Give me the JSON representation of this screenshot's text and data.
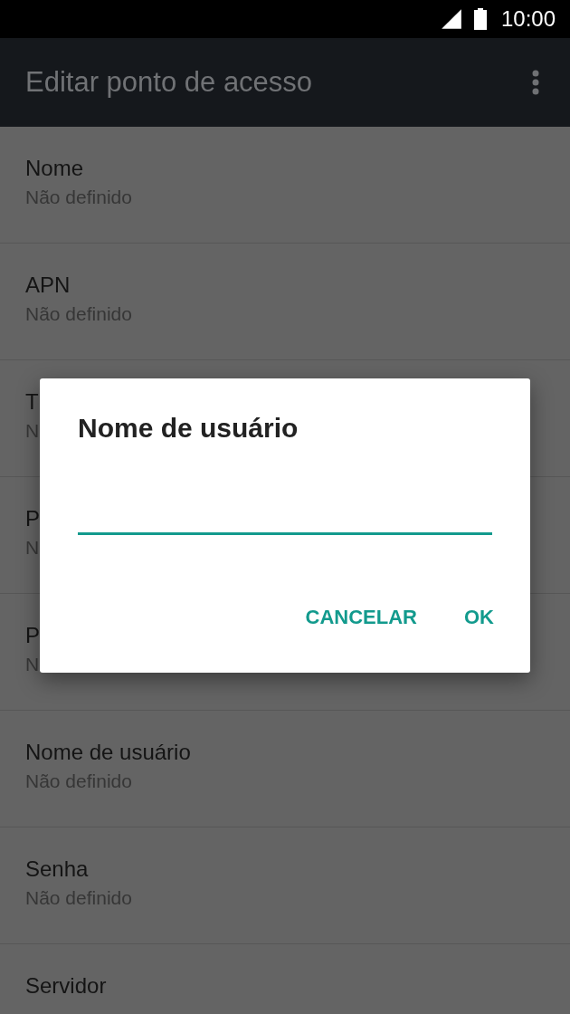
{
  "status_bar": {
    "time": "10:00"
  },
  "app_bar": {
    "title": "Editar ponto de acesso"
  },
  "settings": [
    {
      "title": "Nome",
      "summary": "Não definido"
    },
    {
      "title": "APN",
      "summary": "Não definido"
    },
    {
      "title": "T",
      "summary": "N"
    },
    {
      "title": "P",
      "summary": "N"
    },
    {
      "title": "P",
      "summary": "N"
    },
    {
      "title": "Nome de usuário",
      "summary": "Não definido"
    },
    {
      "title": "Senha",
      "summary": "Não definido"
    },
    {
      "title": "Servidor"
    }
  ],
  "dialog": {
    "title": "Nome de usuário",
    "buttons": [
      "CANCELAR",
      "OK"
    ]
  }
}
